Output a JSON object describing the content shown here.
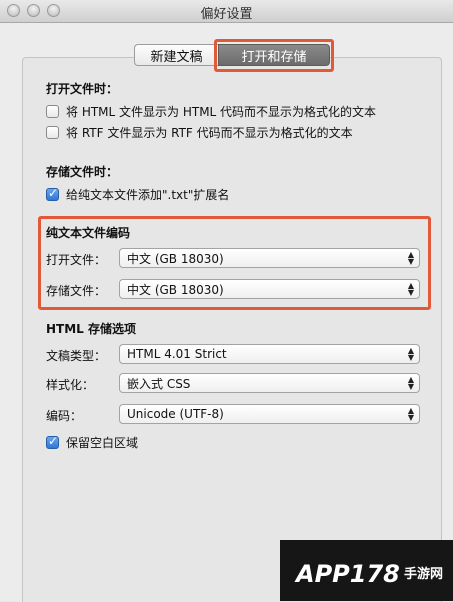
{
  "window": {
    "title": "偏好设置"
  },
  "tabs": {
    "new_doc": "新建文稿",
    "open_save": "打开和存储"
  },
  "open_section": {
    "heading": "打开文件时：",
    "html_option": "将 HTML 文件显示为 HTML 代码而不显示为格式化的文本",
    "rtf_option": "将 RTF 文件显示为 RTF 代码而不显示为格式化的文本"
  },
  "save_section": {
    "heading": "存储文件时：",
    "txt_option": "给纯文本文件添加\".txt\"扩展名"
  },
  "encoding_section": {
    "heading": "纯文本文件编码",
    "open_label": "打开文件：",
    "open_value": "中文 (GB 18030)",
    "save_label": "存储文件：",
    "save_value": "中文 (GB 18030)"
  },
  "html_section": {
    "heading": "HTML 存储选项",
    "doctype_label": "文稿类型：",
    "doctype_value": "HTML 4.01 Strict",
    "style_label": "样式化：",
    "style_value": "嵌入式 CSS",
    "encoding_label": "编码：",
    "encoding_value": "Unicode (UTF-8)",
    "whitespace_option": "保留空白区域"
  },
  "watermark": {
    "brand": "APP178",
    "sub": "手游网"
  },
  "colors": {
    "highlight": "#e05a3a",
    "checkbox_blue": "#2f78d8"
  }
}
